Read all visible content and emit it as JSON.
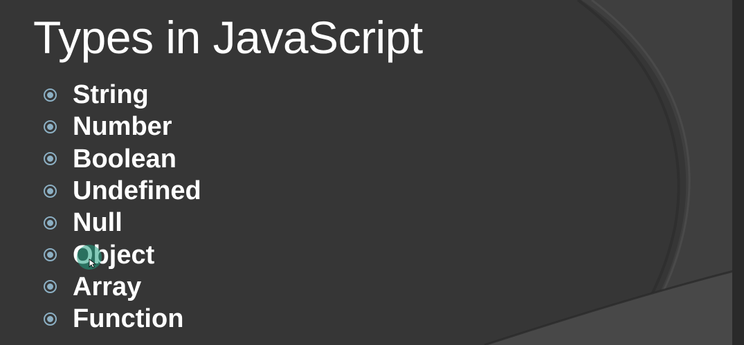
{
  "slide": {
    "title": "Types in JavaScript",
    "bullet_icon": "circled-dot-bullet-icon",
    "items": [
      {
        "label": "String"
      },
      {
        "label": "Number"
      },
      {
        "label": "Boolean"
      },
      {
        "label": "Undefined"
      },
      {
        "label": "Null"
      },
      {
        "label": "Object"
      },
      {
        "label": "Array"
      },
      {
        "label": "Function"
      }
    ]
  },
  "colors": {
    "background": "#363636",
    "arc_shade": "#404040",
    "title_text": "#ffffff",
    "bullet_text": "#ffffff",
    "bullet_icon": "#8cb0c4",
    "cursor_highlight": "#20a082"
  }
}
